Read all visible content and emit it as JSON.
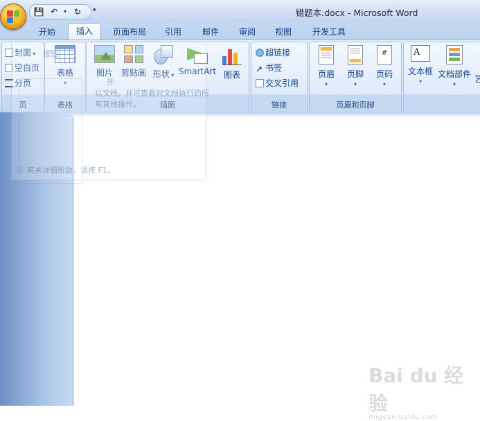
{
  "window": {
    "title": "错题本.docx - Microsoft Word"
  },
  "colors": {
    "accent": "#15428b",
    "ribbon_bg": "#dae7f8",
    "orb": "#f0a30a"
  },
  "quick_access": [
    {
      "icon": "save-icon",
      "glyph": "💾"
    },
    {
      "icon": "undo-icon",
      "glyph": "↶"
    },
    {
      "icon": "redo-icon",
      "glyph": "↻"
    }
  ],
  "tabs": [
    "开始",
    "插入",
    "页面布局",
    "引用",
    "邮件",
    "审阅",
    "视图",
    "开发工具"
  ],
  "active_tab": "插入",
  "ribbon": {
    "pages": {
      "label": "页",
      "items": [
        "封面",
        "空白页",
        "分页"
      ]
    },
    "tables": {
      "label": "表格",
      "button": "表格"
    },
    "illustrations": {
      "label": "插图",
      "buttons": [
        "图片",
        "剪贴画",
        "形状",
        "SmartArt",
        "图表"
      ]
    },
    "links": {
      "label": "链接",
      "items": [
        "超链接",
        "书签",
        "交叉引用"
      ]
    },
    "header_footer": {
      "label": "页眉和页脚",
      "buttons": [
        "页眉",
        "页脚",
        "页码"
      ]
    },
    "text": {
      "buttons": [
        "文本框",
        "文档部件",
        "艺"
      ]
    }
  },
  "ghost_tooltip": {
    "line1": "按钮",
    "line2": "开",
    "body": "以文档，并可查看对文档执行的所有其他操作。",
    "help": "有关详细帮助，请按 F1。"
  },
  "watermark": {
    "brand": "Bai du 经验",
    "url": "jingyan.baidu.com"
  }
}
